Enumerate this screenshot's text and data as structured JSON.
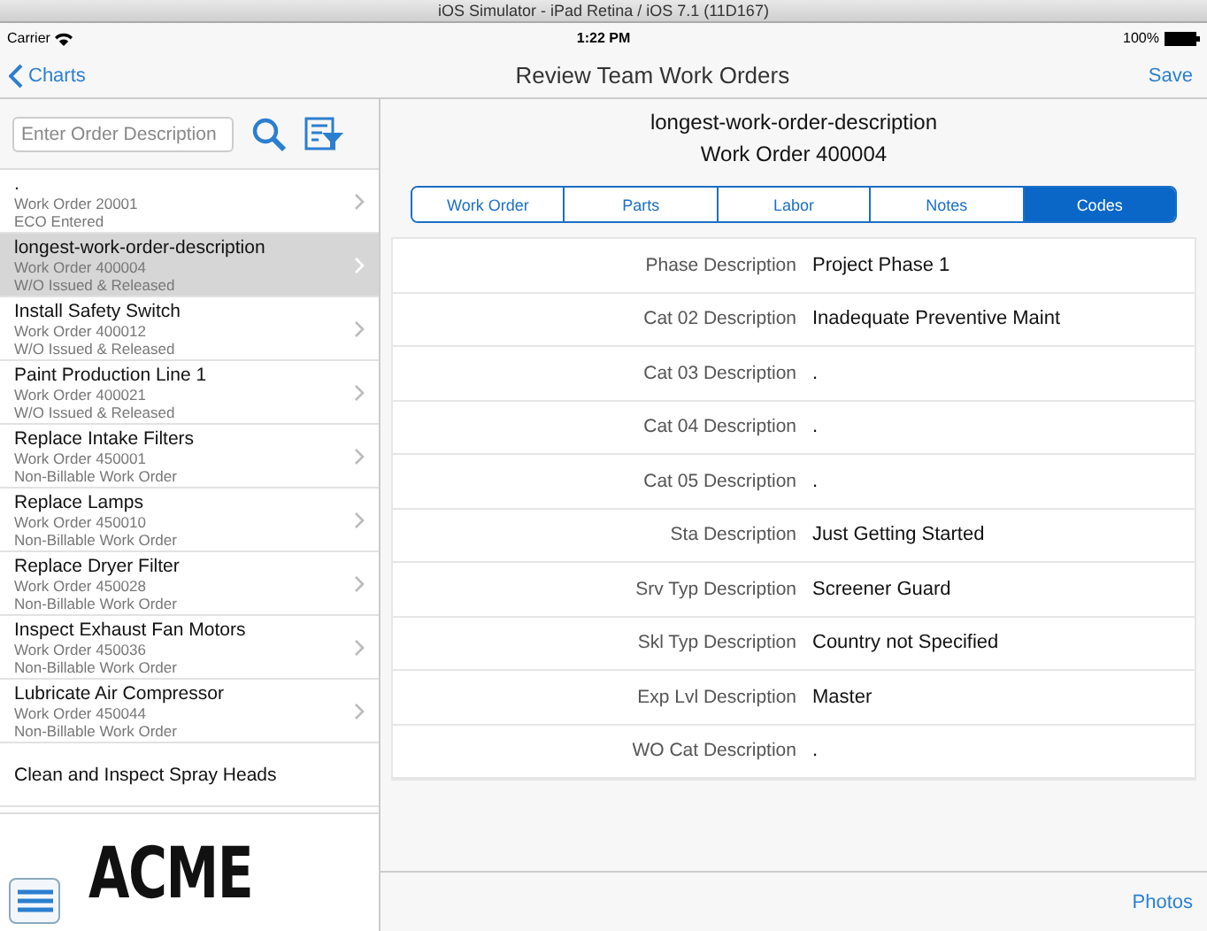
{
  "window": {
    "title": "iOS Simulator - iPad Retina / iOS 7.1 (11D167)"
  },
  "status_bar": {
    "carrier": "Carrier",
    "time": "1:22 PM",
    "battery": "100%"
  },
  "nav_bar": {
    "back": "Charts",
    "title": "Review Team Work Orders",
    "action": "Save"
  },
  "search": {
    "placeholder": "Enter Order Description"
  },
  "orders": [
    {
      "title": ".",
      "number": "Work Order 20001",
      "status": "ECO Entered",
      "selected": false
    },
    {
      "title": "longest-work-order-description",
      "number": "Work Order 400004",
      "status": "W/O Issued & Released",
      "selected": true
    },
    {
      "title": "Install Safety Switch",
      "number": "Work Order 400012",
      "status": "W/O Issued & Released",
      "selected": false
    },
    {
      "title": "Paint Production Line 1",
      "number": "Work Order 400021",
      "status": "W/O Issued & Released",
      "selected": false
    },
    {
      "title": "Replace Intake Filters",
      "number": "Work Order 450001",
      "status": "Non-Billable Work Order",
      "selected": false
    },
    {
      "title": "Replace Lamps",
      "number": "Work Order 450010",
      "status": "Non-Billable Work Order",
      "selected": false
    },
    {
      "title": "Replace Dryer Filter",
      "number": "Work Order 450028",
      "status": "Non-Billable Work Order",
      "selected": false
    },
    {
      "title": "Inspect Exhaust Fan Motors",
      "number": "Work Order 450036",
      "status": "Non-Billable Work Order",
      "selected": false
    },
    {
      "title": "Lubricate Air Compressor",
      "number": "Work Order 450044",
      "status": "Non-Billable Work Order",
      "selected": false
    },
    {
      "title": "Clean and Inspect Spray Heads",
      "selected": false
    }
  ],
  "logo": "ACME",
  "detail": {
    "title": "longest-work-order-description",
    "subtitle": "Work Order 400004"
  },
  "tabs": [
    {
      "label": "Work Order",
      "selected": false
    },
    {
      "label": "Parts",
      "selected": false
    },
    {
      "label": "Labor",
      "selected": false
    },
    {
      "label": "Notes",
      "selected": false
    },
    {
      "label": "Codes",
      "selected": true
    }
  ],
  "codes": [
    {
      "label": "Phase Description",
      "value": "Project Phase 1"
    },
    {
      "label": "Cat 02 Description",
      "value": "Inadequate Preventive Maint"
    },
    {
      "label": "Cat 03 Description",
      "value": "."
    },
    {
      "label": "Cat 04 Description",
      "value": "."
    },
    {
      "label": "Cat 05 Description",
      "value": "."
    },
    {
      "label": "Sta Description",
      "value": "Just Getting Started"
    },
    {
      "label": "Srv Typ Description",
      "value": "Screener Guard"
    },
    {
      "label": "Skl Typ Description",
      "value": "Country not Specified"
    },
    {
      "label": "Exp Lvl Description",
      "value": "Master"
    },
    {
      "label": "WO Cat Description",
      "value": "."
    }
  ],
  "footer": {
    "action": "Photos"
  }
}
